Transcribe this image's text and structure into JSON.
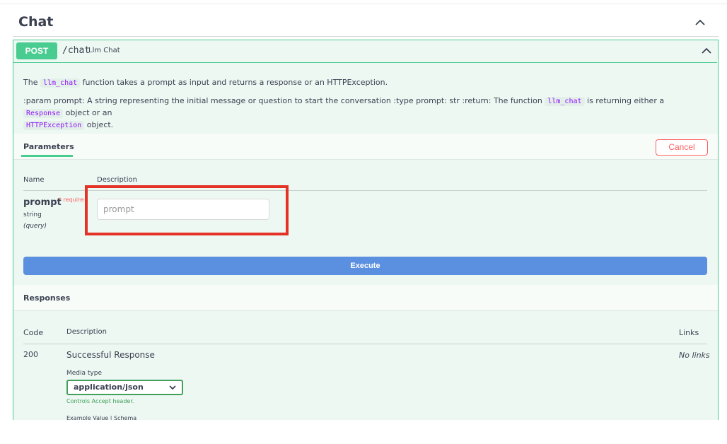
{
  "tag": {
    "title": "Chat"
  },
  "operation": {
    "method": "POST",
    "path": "/chat",
    "summary": "Llm Chat",
    "description_line1": {
      "before": "The ",
      "code1": "llm_chat",
      "after": " function takes a prompt as input and returns a response or an HTTPException."
    },
    "description_line2": {
      "text1": ":param prompt: A string representing the initial message or question to start the conversation :type prompt: str :return: The function ",
      "code1": "llm_chat",
      "text2": " is returning either a ",
      "code2": "Response",
      "text3": " object or an ",
      "code3": "HTTPException",
      "text4": " object."
    }
  },
  "parameters": {
    "tab_label": "Parameters",
    "cancel_label": "Cancel",
    "col_name": "Name",
    "col_description": "Description",
    "items": [
      {
        "name": "prompt",
        "required": "* required",
        "type": "string",
        "in": "(query)",
        "placeholder": "prompt"
      }
    ]
  },
  "execute_label": "Execute",
  "responses": {
    "title": "Responses",
    "col_code": "Code",
    "col_description": "Description",
    "col_links": "Links",
    "rows": [
      {
        "code": "200",
        "description": "Successful Response",
        "links": "No links",
        "media_type_label": "Media type",
        "media_type_value": "application/json",
        "controls_text": "Controls Accept header.",
        "example_text": "Example Value | Schema"
      }
    ]
  },
  "colors": {
    "post": "#49cc90",
    "execute": "#5b8fe0",
    "cancel": "#ff6060",
    "highlight": "#e53227"
  }
}
